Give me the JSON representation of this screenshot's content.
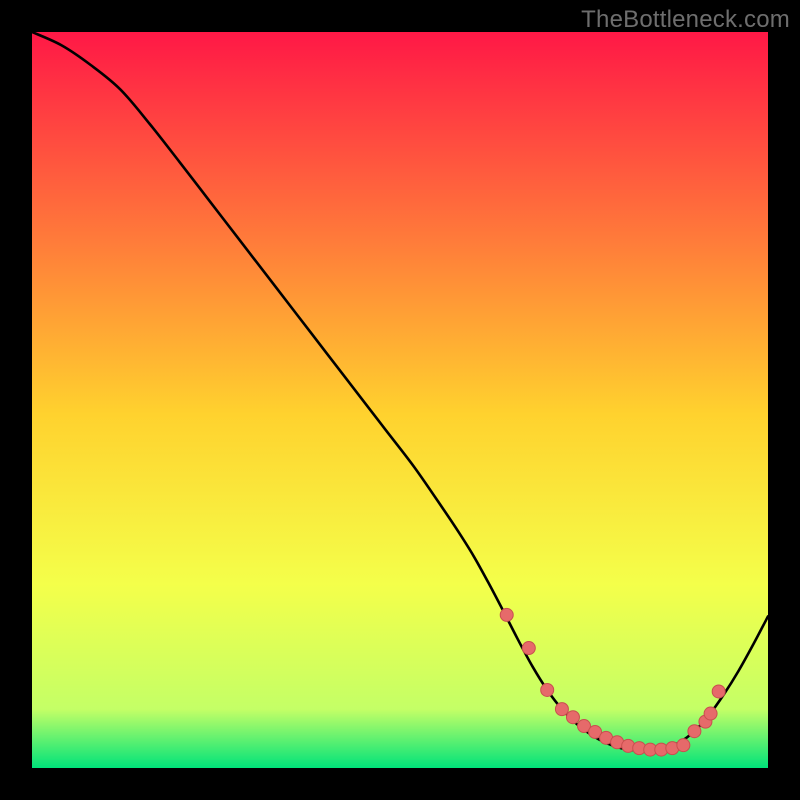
{
  "watermark": "TheBottleneck.com",
  "colors": {
    "frame": "#000000",
    "curve": "#000000",
    "dot_fill": "#e66a6a",
    "dot_stroke": "#c94f4f",
    "grad_top": "#ff1846",
    "grad_q1": "#ff7a3a",
    "grad_mid": "#ffd22e",
    "grad_q3": "#f4ff4a",
    "grad_nearbot": "#c4ff66",
    "grad_bot": "#00e37a"
  },
  "chart_data": {
    "type": "line",
    "title": "",
    "xlabel": "",
    "ylabel": "",
    "xlim": [
      0,
      100
    ],
    "ylim": [
      0,
      100
    ],
    "grid": false,
    "legend": false,
    "annotations": [],
    "series": [
      {
        "name": "curve",
        "x": [
          0,
          4,
          8,
          12,
          16,
          20,
          24,
          28,
          32,
          36,
          40,
          44,
          48,
          52,
          56,
          58,
          60,
          62,
          64,
          66,
          68,
          70,
          72,
          74,
          76,
          78,
          80,
          82,
          84,
          86,
          88,
          90,
          92,
          94,
          96,
          98,
          100
        ],
        "y": [
          100,
          98.2,
          95.5,
          92.2,
          87.5,
          82.4,
          77.2,
          72.0,
          66.8,
          61.6,
          56.4,
          51.2,
          46.0,
          40.8,
          35.0,
          32.0,
          28.8,
          25.2,
          21.4,
          17.5,
          13.8,
          10.6,
          8.0,
          6.0,
          4.5,
          3.4,
          2.7,
          2.4,
          2.4,
          2.7,
          3.5,
          5.0,
          7.2,
          10.0,
          13.2,
          16.8,
          20.6
        ]
      }
    ],
    "dots": {
      "name": "highlight-points",
      "x": [
        64.5,
        67.5,
        70.0,
        72.0,
        73.5,
        75.0,
        76.5,
        78.0,
        79.5,
        81.0,
        82.5,
        84.0,
        85.5,
        87.0,
        88.5,
        90.0,
        91.5,
        92.2,
        93.3
      ],
      "y": [
        20.8,
        16.3,
        10.6,
        8.0,
        6.9,
        5.7,
        4.9,
        4.1,
        3.5,
        3.0,
        2.7,
        2.5,
        2.5,
        2.7,
        3.1,
        5.0,
        6.3,
        7.4,
        10.4
      ]
    }
  }
}
